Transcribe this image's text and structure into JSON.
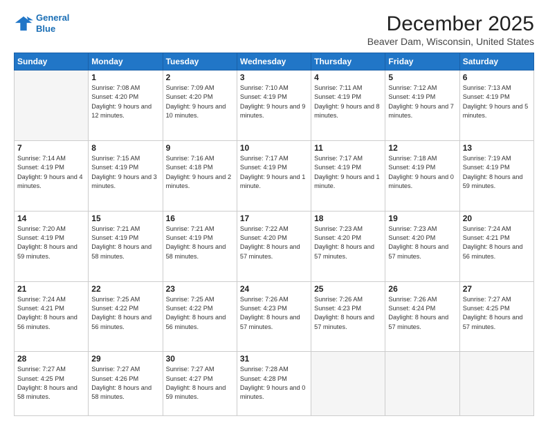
{
  "logo": {
    "line1": "General",
    "line2": "Blue"
  },
  "title": "December 2025",
  "subtitle": "Beaver Dam, Wisconsin, United States",
  "headers": [
    "Sunday",
    "Monday",
    "Tuesday",
    "Wednesday",
    "Thursday",
    "Friday",
    "Saturday"
  ],
  "weeks": [
    [
      {
        "day": "",
        "sunrise": "",
        "sunset": "",
        "daylight": ""
      },
      {
        "day": "1",
        "sunrise": "Sunrise: 7:08 AM",
        "sunset": "Sunset: 4:20 PM",
        "daylight": "Daylight: 9 hours and 12 minutes."
      },
      {
        "day": "2",
        "sunrise": "Sunrise: 7:09 AM",
        "sunset": "Sunset: 4:20 PM",
        "daylight": "Daylight: 9 hours and 10 minutes."
      },
      {
        "day": "3",
        "sunrise": "Sunrise: 7:10 AM",
        "sunset": "Sunset: 4:19 PM",
        "daylight": "Daylight: 9 hours and 9 minutes."
      },
      {
        "day": "4",
        "sunrise": "Sunrise: 7:11 AM",
        "sunset": "Sunset: 4:19 PM",
        "daylight": "Daylight: 9 hours and 8 minutes."
      },
      {
        "day": "5",
        "sunrise": "Sunrise: 7:12 AM",
        "sunset": "Sunset: 4:19 PM",
        "daylight": "Daylight: 9 hours and 7 minutes."
      },
      {
        "day": "6",
        "sunrise": "Sunrise: 7:13 AM",
        "sunset": "Sunset: 4:19 PM",
        "daylight": "Daylight: 9 hours and 5 minutes."
      }
    ],
    [
      {
        "day": "7",
        "sunrise": "Sunrise: 7:14 AM",
        "sunset": "Sunset: 4:19 PM",
        "daylight": "Daylight: 9 hours and 4 minutes."
      },
      {
        "day": "8",
        "sunrise": "Sunrise: 7:15 AM",
        "sunset": "Sunset: 4:19 PM",
        "daylight": "Daylight: 9 hours and 3 minutes."
      },
      {
        "day": "9",
        "sunrise": "Sunrise: 7:16 AM",
        "sunset": "Sunset: 4:18 PM",
        "daylight": "Daylight: 9 hours and 2 minutes."
      },
      {
        "day": "10",
        "sunrise": "Sunrise: 7:17 AM",
        "sunset": "Sunset: 4:19 PM",
        "daylight": "Daylight: 9 hours and 1 minute."
      },
      {
        "day": "11",
        "sunrise": "Sunrise: 7:17 AM",
        "sunset": "Sunset: 4:19 PM",
        "daylight": "Daylight: 9 hours and 1 minute."
      },
      {
        "day": "12",
        "sunrise": "Sunrise: 7:18 AM",
        "sunset": "Sunset: 4:19 PM",
        "daylight": "Daylight: 9 hours and 0 minutes."
      },
      {
        "day": "13",
        "sunrise": "Sunrise: 7:19 AM",
        "sunset": "Sunset: 4:19 PM",
        "daylight": "Daylight: 8 hours and 59 minutes."
      }
    ],
    [
      {
        "day": "14",
        "sunrise": "Sunrise: 7:20 AM",
        "sunset": "Sunset: 4:19 PM",
        "daylight": "Daylight: 8 hours and 59 minutes."
      },
      {
        "day": "15",
        "sunrise": "Sunrise: 7:21 AM",
        "sunset": "Sunset: 4:19 PM",
        "daylight": "Daylight: 8 hours and 58 minutes."
      },
      {
        "day": "16",
        "sunrise": "Sunrise: 7:21 AM",
        "sunset": "Sunset: 4:19 PM",
        "daylight": "Daylight: 8 hours and 58 minutes."
      },
      {
        "day": "17",
        "sunrise": "Sunrise: 7:22 AM",
        "sunset": "Sunset: 4:20 PM",
        "daylight": "Daylight: 8 hours and 57 minutes."
      },
      {
        "day": "18",
        "sunrise": "Sunrise: 7:23 AM",
        "sunset": "Sunset: 4:20 PM",
        "daylight": "Daylight: 8 hours and 57 minutes."
      },
      {
        "day": "19",
        "sunrise": "Sunrise: 7:23 AM",
        "sunset": "Sunset: 4:20 PM",
        "daylight": "Daylight: 8 hours and 57 minutes."
      },
      {
        "day": "20",
        "sunrise": "Sunrise: 7:24 AM",
        "sunset": "Sunset: 4:21 PM",
        "daylight": "Daylight: 8 hours and 56 minutes."
      }
    ],
    [
      {
        "day": "21",
        "sunrise": "Sunrise: 7:24 AM",
        "sunset": "Sunset: 4:21 PM",
        "daylight": "Daylight: 8 hours and 56 minutes."
      },
      {
        "day": "22",
        "sunrise": "Sunrise: 7:25 AM",
        "sunset": "Sunset: 4:22 PM",
        "daylight": "Daylight: 8 hours and 56 minutes."
      },
      {
        "day": "23",
        "sunrise": "Sunrise: 7:25 AM",
        "sunset": "Sunset: 4:22 PM",
        "daylight": "Daylight: 8 hours and 56 minutes."
      },
      {
        "day": "24",
        "sunrise": "Sunrise: 7:26 AM",
        "sunset": "Sunset: 4:23 PM",
        "daylight": "Daylight: 8 hours and 57 minutes."
      },
      {
        "day": "25",
        "sunrise": "Sunrise: 7:26 AM",
        "sunset": "Sunset: 4:23 PM",
        "daylight": "Daylight: 8 hours and 57 minutes."
      },
      {
        "day": "26",
        "sunrise": "Sunrise: 7:26 AM",
        "sunset": "Sunset: 4:24 PM",
        "daylight": "Daylight: 8 hours and 57 minutes."
      },
      {
        "day": "27",
        "sunrise": "Sunrise: 7:27 AM",
        "sunset": "Sunset: 4:25 PM",
        "daylight": "Daylight: 8 hours and 57 minutes."
      }
    ],
    [
      {
        "day": "28",
        "sunrise": "Sunrise: 7:27 AM",
        "sunset": "Sunset: 4:25 PM",
        "daylight": "Daylight: 8 hours and 58 minutes."
      },
      {
        "day": "29",
        "sunrise": "Sunrise: 7:27 AM",
        "sunset": "Sunset: 4:26 PM",
        "daylight": "Daylight: 8 hours and 58 minutes."
      },
      {
        "day": "30",
        "sunrise": "Sunrise: 7:27 AM",
        "sunset": "Sunset: 4:27 PM",
        "daylight": "Daylight: 8 hours and 59 minutes."
      },
      {
        "day": "31",
        "sunrise": "Sunrise: 7:28 AM",
        "sunset": "Sunset: 4:28 PM",
        "daylight": "Daylight: 9 hours and 0 minutes."
      },
      {
        "day": "",
        "sunrise": "",
        "sunset": "",
        "daylight": ""
      },
      {
        "day": "",
        "sunrise": "",
        "sunset": "",
        "daylight": ""
      },
      {
        "day": "",
        "sunrise": "",
        "sunset": "",
        "daylight": ""
      }
    ]
  ]
}
